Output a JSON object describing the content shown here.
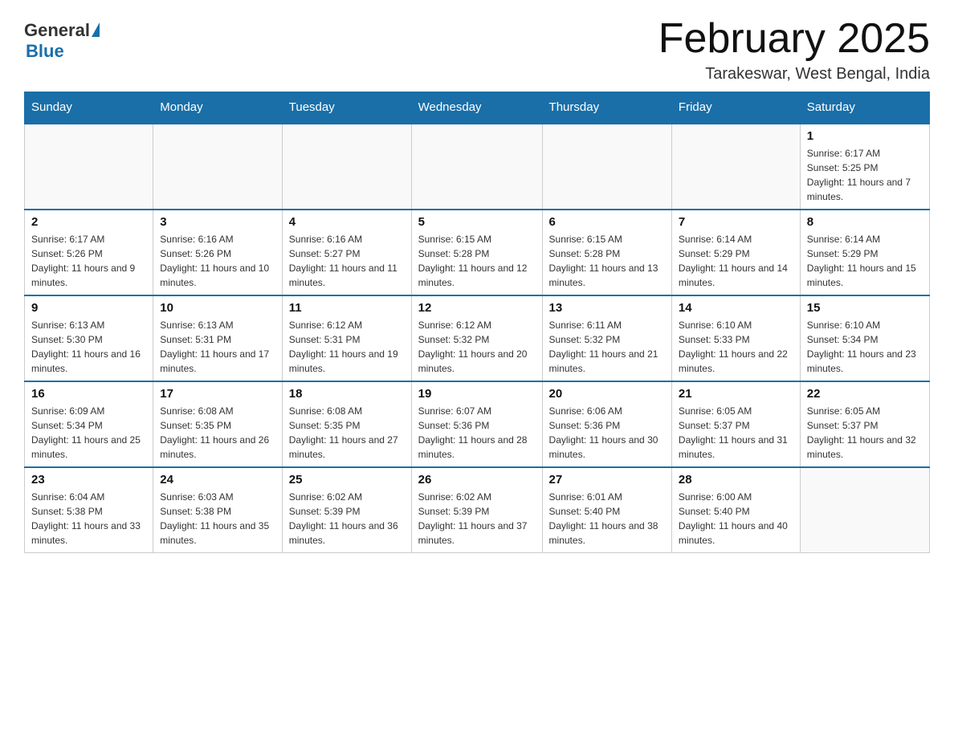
{
  "header": {
    "logo_general": "General",
    "logo_blue": "Blue",
    "title": "February 2025",
    "subtitle": "Tarakeswar, West Bengal, India"
  },
  "days_of_week": [
    "Sunday",
    "Monday",
    "Tuesday",
    "Wednesday",
    "Thursday",
    "Friday",
    "Saturday"
  ],
  "weeks": [
    [
      {
        "day": "",
        "info": ""
      },
      {
        "day": "",
        "info": ""
      },
      {
        "day": "",
        "info": ""
      },
      {
        "day": "",
        "info": ""
      },
      {
        "day": "",
        "info": ""
      },
      {
        "day": "",
        "info": ""
      },
      {
        "day": "1",
        "info": "Sunrise: 6:17 AM\nSunset: 5:25 PM\nDaylight: 11 hours and 7 minutes."
      }
    ],
    [
      {
        "day": "2",
        "info": "Sunrise: 6:17 AM\nSunset: 5:26 PM\nDaylight: 11 hours and 9 minutes."
      },
      {
        "day": "3",
        "info": "Sunrise: 6:16 AM\nSunset: 5:26 PM\nDaylight: 11 hours and 10 minutes."
      },
      {
        "day": "4",
        "info": "Sunrise: 6:16 AM\nSunset: 5:27 PM\nDaylight: 11 hours and 11 minutes."
      },
      {
        "day": "5",
        "info": "Sunrise: 6:15 AM\nSunset: 5:28 PM\nDaylight: 11 hours and 12 minutes."
      },
      {
        "day": "6",
        "info": "Sunrise: 6:15 AM\nSunset: 5:28 PM\nDaylight: 11 hours and 13 minutes."
      },
      {
        "day": "7",
        "info": "Sunrise: 6:14 AM\nSunset: 5:29 PM\nDaylight: 11 hours and 14 minutes."
      },
      {
        "day": "8",
        "info": "Sunrise: 6:14 AM\nSunset: 5:29 PM\nDaylight: 11 hours and 15 minutes."
      }
    ],
    [
      {
        "day": "9",
        "info": "Sunrise: 6:13 AM\nSunset: 5:30 PM\nDaylight: 11 hours and 16 minutes."
      },
      {
        "day": "10",
        "info": "Sunrise: 6:13 AM\nSunset: 5:31 PM\nDaylight: 11 hours and 17 minutes."
      },
      {
        "day": "11",
        "info": "Sunrise: 6:12 AM\nSunset: 5:31 PM\nDaylight: 11 hours and 19 minutes."
      },
      {
        "day": "12",
        "info": "Sunrise: 6:12 AM\nSunset: 5:32 PM\nDaylight: 11 hours and 20 minutes."
      },
      {
        "day": "13",
        "info": "Sunrise: 6:11 AM\nSunset: 5:32 PM\nDaylight: 11 hours and 21 minutes."
      },
      {
        "day": "14",
        "info": "Sunrise: 6:10 AM\nSunset: 5:33 PM\nDaylight: 11 hours and 22 minutes."
      },
      {
        "day": "15",
        "info": "Sunrise: 6:10 AM\nSunset: 5:34 PM\nDaylight: 11 hours and 23 minutes."
      }
    ],
    [
      {
        "day": "16",
        "info": "Sunrise: 6:09 AM\nSunset: 5:34 PM\nDaylight: 11 hours and 25 minutes."
      },
      {
        "day": "17",
        "info": "Sunrise: 6:08 AM\nSunset: 5:35 PM\nDaylight: 11 hours and 26 minutes."
      },
      {
        "day": "18",
        "info": "Sunrise: 6:08 AM\nSunset: 5:35 PM\nDaylight: 11 hours and 27 minutes."
      },
      {
        "day": "19",
        "info": "Sunrise: 6:07 AM\nSunset: 5:36 PM\nDaylight: 11 hours and 28 minutes."
      },
      {
        "day": "20",
        "info": "Sunrise: 6:06 AM\nSunset: 5:36 PM\nDaylight: 11 hours and 30 minutes."
      },
      {
        "day": "21",
        "info": "Sunrise: 6:05 AM\nSunset: 5:37 PM\nDaylight: 11 hours and 31 minutes."
      },
      {
        "day": "22",
        "info": "Sunrise: 6:05 AM\nSunset: 5:37 PM\nDaylight: 11 hours and 32 minutes."
      }
    ],
    [
      {
        "day": "23",
        "info": "Sunrise: 6:04 AM\nSunset: 5:38 PM\nDaylight: 11 hours and 33 minutes."
      },
      {
        "day": "24",
        "info": "Sunrise: 6:03 AM\nSunset: 5:38 PM\nDaylight: 11 hours and 35 minutes."
      },
      {
        "day": "25",
        "info": "Sunrise: 6:02 AM\nSunset: 5:39 PM\nDaylight: 11 hours and 36 minutes."
      },
      {
        "day": "26",
        "info": "Sunrise: 6:02 AM\nSunset: 5:39 PM\nDaylight: 11 hours and 37 minutes."
      },
      {
        "day": "27",
        "info": "Sunrise: 6:01 AM\nSunset: 5:40 PM\nDaylight: 11 hours and 38 minutes."
      },
      {
        "day": "28",
        "info": "Sunrise: 6:00 AM\nSunset: 5:40 PM\nDaylight: 11 hours and 40 minutes."
      },
      {
        "day": "",
        "info": ""
      }
    ]
  ]
}
